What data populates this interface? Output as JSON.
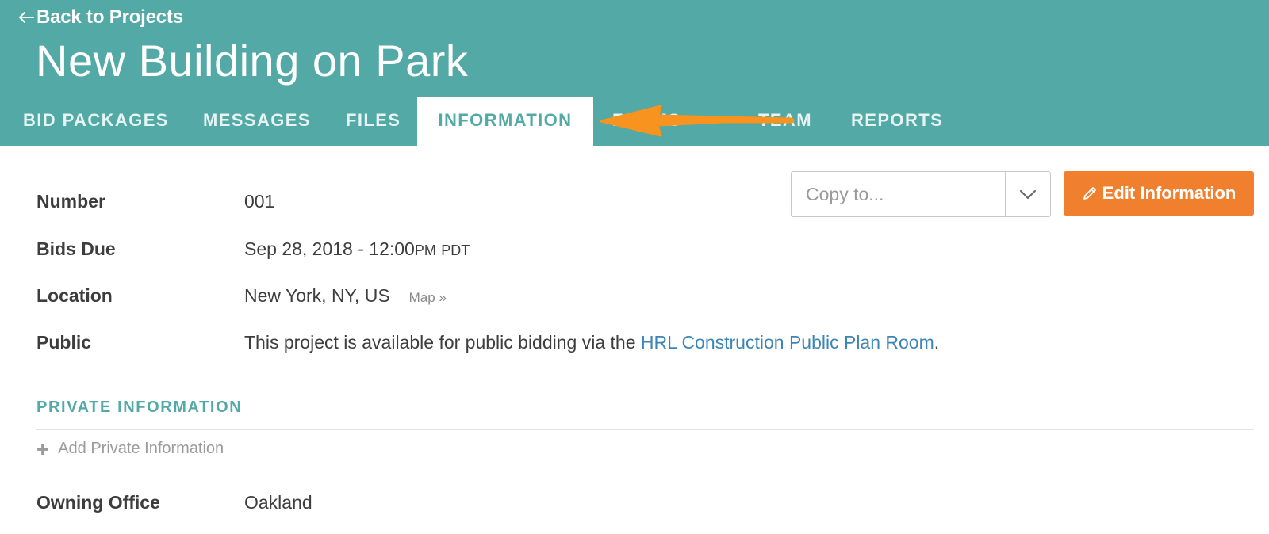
{
  "header": {
    "back_label": "Back to Projects",
    "project_title": "New Building on Park"
  },
  "tabs": [
    {
      "label": "BID PACKAGES",
      "active": false
    },
    {
      "label": "MESSAGES",
      "active": false
    },
    {
      "label": "FILES",
      "active": false
    },
    {
      "label": "INFORMATION",
      "active": true
    },
    {
      "label": "FORMS",
      "active": false
    },
    {
      "label": "TEAM",
      "active": false
    },
    {
      "label": "REPORTS",
      "active": false
    }
  ],
  "actions": {
    "copy_placeholder": "Copy to...",
    "edit_label": "Edit Information"
  },
  "fields": {
    "number": {
      "label": "Number",
      "value": "001"
    },
    "bids_due": {
      "label": "Bids Due",
      "date": "Sep 28, 2018 - 12:00",
      "ampm": "PM",
      "tz": "PDT"
    },
    "location": {
      "label": "Location",
      "value": "New York, NY, US",
      "map_link": "Map »"
    },
    "public": {
      "label": "Public",
      "text_before": "This project is available for public bidding via the ",
      "link": "HRL Construction Public Plan Room",
      "text_after": "."
    },
    "owning_office": {
      "label": "Owning Office",
      "value": "Oakland"
    }
  },
  "private_section": {
    "title": "PRIVATE INFORMATION",
    "add_label": "Add Private Information"
  },
  "colors": {
    "header_teal": "#52a9a6",
    "accent_orange": "#f07f2e",
    "annotation_arrow": "#f7931e",
    "link_blue": "#3d85b6"
  }
}
